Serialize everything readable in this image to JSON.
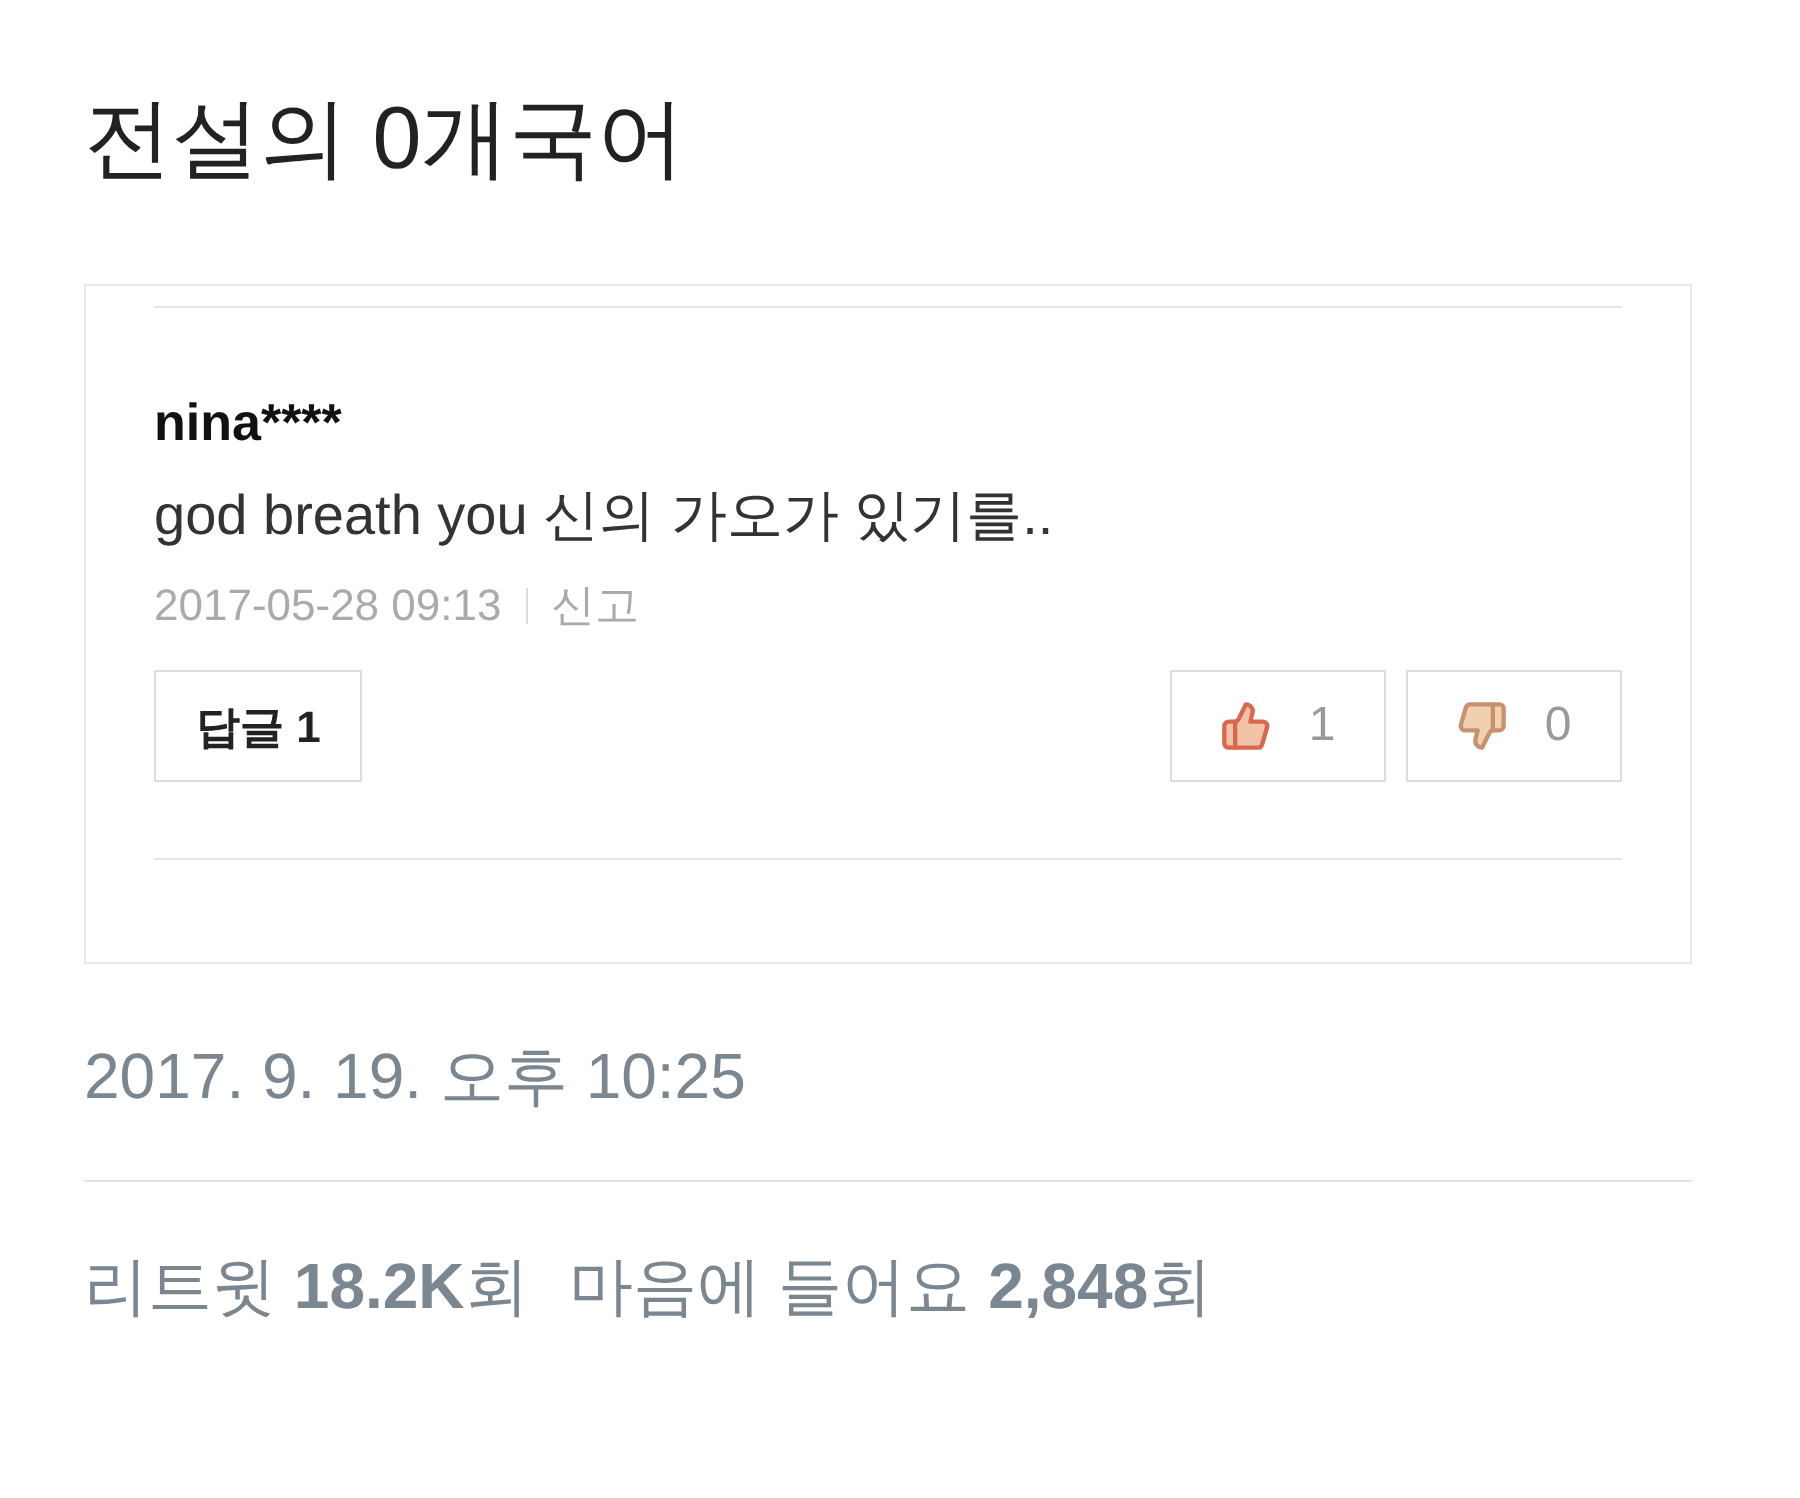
{
  "tweet_text": "전설의 0개국어",
  "comment": {
    "author": "nina****",
    "text": "god breath you 신의 가오가 있기를..",
    "date": "2017-05-28 09:13",
    "report": "신고",
    "reply_button": "답글 1",
    "like_count": "1",
    "dislike_count": "0"
  },
  "timestamp": "2017. 9. 19. 오후 10:25",
  "stats": [
    "리트윗 **18.2K**회",
    "마음에 들어요 **2,848**회"
  ]
}
